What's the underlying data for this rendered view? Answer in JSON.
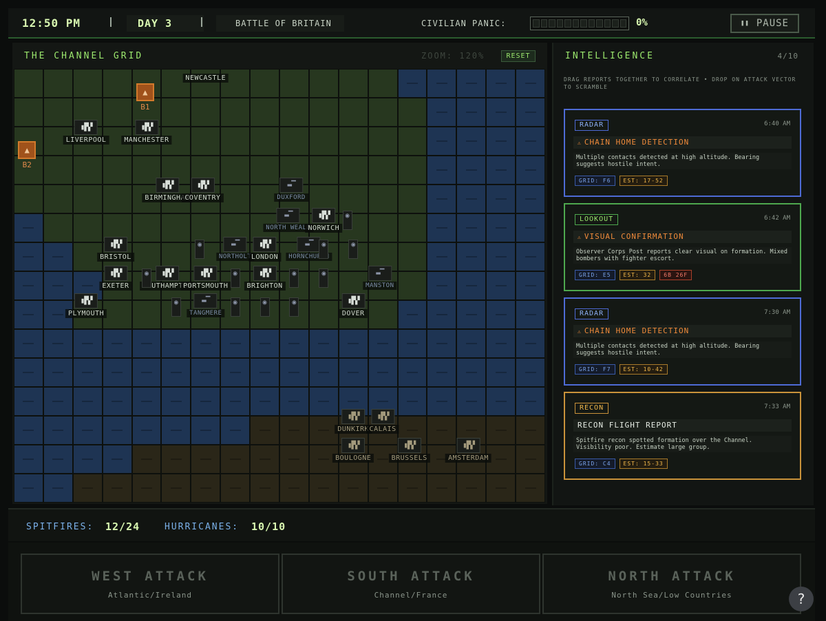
{
  "topbar": {
    "time": "12:50 PM",
    "day": "DAY 3",
    "operation": "BATTLE OF BRITAIN",
    "panic_label": "CIVILIAN PANIC:",
    "panic_value": "0%",
    "panic_fraction": 0,
    "pause_label": "PAUSE",
    "pause_icon": "pause-icon"
  },
  "map": {
    "title": "THE CHANNEL GRID",
    "zoom": "ZOOM: 120%",
    "reset_label": "RESET",
    "grid": [
      "LLLLLLLLLLLLLSSSSS",
      "LLLLLLLLLLLLLLSSSS",
      "LLLLLLLLLLLLLLSSSS",
      "LLLLLLLLLLLLLLSSSS",
      "LLLLLLLLLLLLLLSSSS",
      "SLLLLLLLLLLLLLSSSS",
      "SSLLLLLLLLLLLLSSSS",
      "SSSLLLLLLLLLLLSSSS",
      "SSLLLLLLLLLLLSSSSS",
      "SSSSSSSSSSSSSSSSSS",
      "SSSSSSSSSSSSSSSSSS",
      "SSSSSSSSSSSSSSSSSS",
      "SSSSSSSSCCCCCCCCCC",
      "SSSSCCCCCCCCCCCCCC",
      "SSCCCCCCCCCCCCCCCC"
    ],
    "cities": [
      {
        "name": "NEWCASTLE",
        "col": 6.5,
        "row": 0.15,
        "type": "nobox"
      },
      {
        "name": "LIVERPOOL",
        "col": 2.45,
        "row": 1.75,
        "type": "land"
      },
      {
        "name": "MANCHESTER",
        "col": 4.5,
        "row": 1.75,
        "type": "land"
      },
      {
        "name": "BIRMINGHAM",
        "col": 5.2,
        "row": 3.75,
        "type": "land"
      },
      {
        "name": "COVENTRY",
        "col": 6.4,
        "row": 3.75,
        "type": "land"
      },
      {
        "name": "DUXFORD",
        "col": 9.4,
        "row": 3.75,
        "type": "dim"
      },
      {
        "name": "NORTH WEALD",
        "col": 9.3,
        "row": 4.8,
        "type": "dim"
      },
      {
        "name": "NORWICH",
        "col": 10.5,
        "row": 4.8,
        "type": "land"
      },
      {
        "name": "BRISTOL",
        "col": 3.45,
        "row": 5.8,
        "type": "land"
      },
      {
        "name": "NORTHOLT",
        "col": 7.5,
        "row": 5.8,
        "type": "dim"
      },
      {
        "name": "LONDON",
        "col": 8.5,
        "row": 5.8,
        "type": "land"
      },
      {
        "name": "HORNCHURCH",
        "col": 10.0,
        "row": 5.8,
        "type": "dim"
      },
      {
        "name": "EXETER",
        "col": 3.45,
        "row": 6.8,
        "type": "land"
      },
      {
        "name": "SOUTHAMPTON",
        "col": 5.2,
        "row": 6.8,
        "type": "land"
      },
      {
        "name": "PORTSMOUTH",
        "col": 6.5,
        "row": 6.8,
        "type": "land"
      },
      {
        "name": "BRIGHTON",
        "col": 8.5,
        "row": 6.8,
        "type": "land"
      },
      {
        "name": "MANSTON",
        "col": 12.4,
        "row": 6.8,
        "type": "dim"
      },
      {
        "name": "PLYMOUTH",
        "col": 2.45,
        "row": 7.75,
        "type": "land"
      },
      {
        "name": "TANGMERE",
        "col": 6.5,
        "row": 7.75,
        "type": "dim"
      },
      {
        "name": "DOVER",
        "col": 11.5,
        "row": 7.75,
        "type": "land"
      },
      {
        "name": "DUNKIRK",
        "col": 11.5,
        "row": 11.75,
        "type": "cont"
      },
      {
        "name": "CALAIS",
        "col": 12.5,
        "row": 11.75,
        "type": "cont"
      },
      {
        "name": "BOULOGNE",
        "col": 11.5,
        "row": 12.75,
        "type": "cont"
      },
      {
        "name": "BRUSSELS",
        "col": 13.4,
        "row": 12.75,
        "type": "cont"
      },
      {
        "name": "AMSTERDAM",
        "col": 15.4,
        "row": 12.75,
        "type": "cont"
      }
    ],
    "bases": [
      {
        "name": "B1",
        "col": 4.45,
        "row": 0.5
      },
      {
        "name": "B2",
        "col": 0.45,
        "row": 2.5
      }
    ],
    "pins": [
      {
        "col": 11.3,
        "row": 4.9
      },
      {
        "col": 6.3,
        "row": 5.9
      },
      {
        "col": 10.5,
        "row": 5.9
      },
      {
        "col": 11.5,
        "row": 5.9
      },
      {
        "col": 4.5,
        "row": 6.9
      },
      {
        "col": 7.5,
        "row": 6.9
      },
      {
        "col": 9.5,
        "row": 6.9
      },
      {
        "col": 10.5,
        "row": 6.9
      },
      {
        "col": 5.5,
        "row": 7.9
      },
      {
        "col": 7.5,
        "row": 7.9
      },
      {
        "col": 8.5,
        "row": 7.9
      },
      {
        "col": 9.5,
        "row": 7.9
      }
    ]
  },
  "intel": {
    "title": "INTELLIGENCE",
    "count": "4/10",
    "help": "DRAG REPORTS TOGETHER TO CORRELATE • DROP ON ATTACK VECTOR TO SCRAMBLE",
    "cards": [
      {
        "kind": "radar",
        "tag": "RADAR",
        "time": "6:40 AM",
        "headline": "CHAIN HOME DETECTION",
        "warn": true,
        "body": "Multiple contacts detected at high altitude. Bearing suggests hostile intent.",
        "grid": "GRID: F6",
        "est": "EST: 17-52",
        "extra": ""
      },
      {
        "kind": "lookout",
        "tag": "LOOKOUT",
        "time": "6:42 AM",
        "headline": "VISUAL CONFIRMATION",
        "warn": true,
        "body": "Observer Corps Post reports clear visual on formation. Mixed bombers with fighter escort.",
        "grid": "GRID: E5",
        "est": "EST: 32",
        "extra": "6B 26F"
      },
      {
        "kind": "radar",
        "tag": "RADAR",
        "time": "7:30 AM",
        "headline": "CHAIN HOME DETECTION",
        "warn": true,
        "body": "Multiple contacts detected at high altitude. Bearing suggests hostile intent.",
        "grid": "GRID: F7",
        "est": "EST: 10-42",
        "extra": ""
      },
      {
        "kind": "recon",
        "tag": "RECON",
        "time": "7:33 AM",
        "headline": "RECON FLIGHT REPORT",
        "warn": false,
        "body": "Spitfire recon spotted formation over the Channel. Visibility poor. Estimate large group.",
        "grid": "GRID: C4",
        "est": "EST: 15-33",
        "extra": ""
      }
    ]
  },
  "fleet": {
    "spitfires_label": "SPITFIRES:",
    "spitfires_value": "12/24",
    "hurricanes_label": "HURRICANES:",
    "hurricanes_value": "10/10"
  },
  "vectors": [
    {
      "title": "WEST ATTACK",
      "subtitle": "Atlantic/Ireland"
    },
    {
      "title": "SOUTH ATTACK",
      "subtitle": "Channel/France"
    },
    {
      "title": "NORTH ATTACK",
      "subtitle": "North Sea/Low Countries"
    }
  ],
  "help_label": "?"
}
